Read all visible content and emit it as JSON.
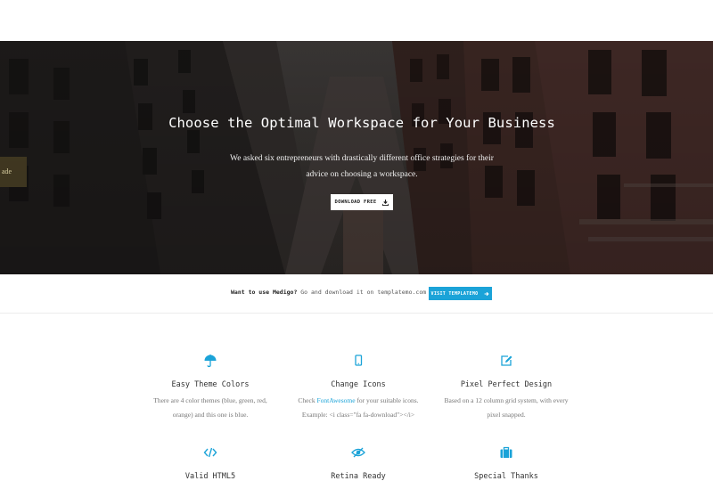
{
  "hero": {
    "title": "Choose the Optimal Workspace for Your Business",
    "subtitle": "We asked six entrepreneurs with drastically different office strategies for their advice on choosing a workspace.",
    "download_label": "DOWNLOAD FREE",
    "download_icon": "download-icon",
    "sign_text": "ade"
  },
  "promo": {
    "lead": "Want to use Medigo?",
    "rest": " Go and download it on templatemo.com",
    "button_label": "VISIT TEMPLATEMO",
    "button_icon": "arrow-right-icon"
  },
  "colors": {
    "accent": "#1ba3d8",
    "hero_overlay": "#2a2624",
    "text_muted": "#777777"
  },
  "features": [
    {
      "icon": "umbrella-icon",
      "title": "Easy Theme Colors",
      "desc": "There are 4 color themes (blue, green, red, orange) and this one is blue."
    },
    {
      "icon": "mobile-icon",
      "title": "Change Icons",
      "desc_before": "Check ",
      "desc_link": "FontAwesome",
      "desc_after": " for your suitable icons.",
      "desc_line2": "Example: <i class=\"fa fa-download\"></i>"
    },
    {
      "icon": "edit-icon",
      "title": "Pixel Perfect Design",
      "desc": "Based on a 12 column grid system, with every pixel snapped."
    },
    {
      "icon": "code-icon",
      "title": "Valid HTML5"
    },
    {
      "icon": "eye-slash-icon",
      "title": "Retina Ready"
    },
    {
      "icon": "briefcase-icon",
      "title": "Special Thanks"
    }
  ]
}
